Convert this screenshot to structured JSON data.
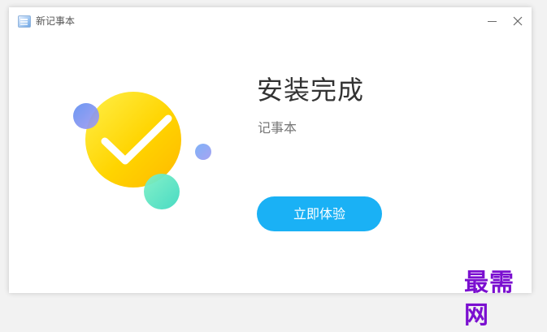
{
  "window": {
    "title": "新记事本"
  },
  "main": {
    "headline": "安装完成",
    "app_name": "记事本",
    "cta_label": "立即体验"
  },
  "illustration": {
    "icon": "check-icon",
    "colors": {
      "main_circle": "#ffd400",
      "blue_bubble": "#7f97f0",
      "small_blue_bubble": "#90aaf5",
      "green_bubble": "#57e0b8"
    }
  },
  "colors": {
    "accent": "#1ab1f5",
    "headline": "#333333",
    "subtitle": "#777777"
  },
  "watermark": {
    "text": "最需网",
    "color": "#7b0fd0"
  }
}
